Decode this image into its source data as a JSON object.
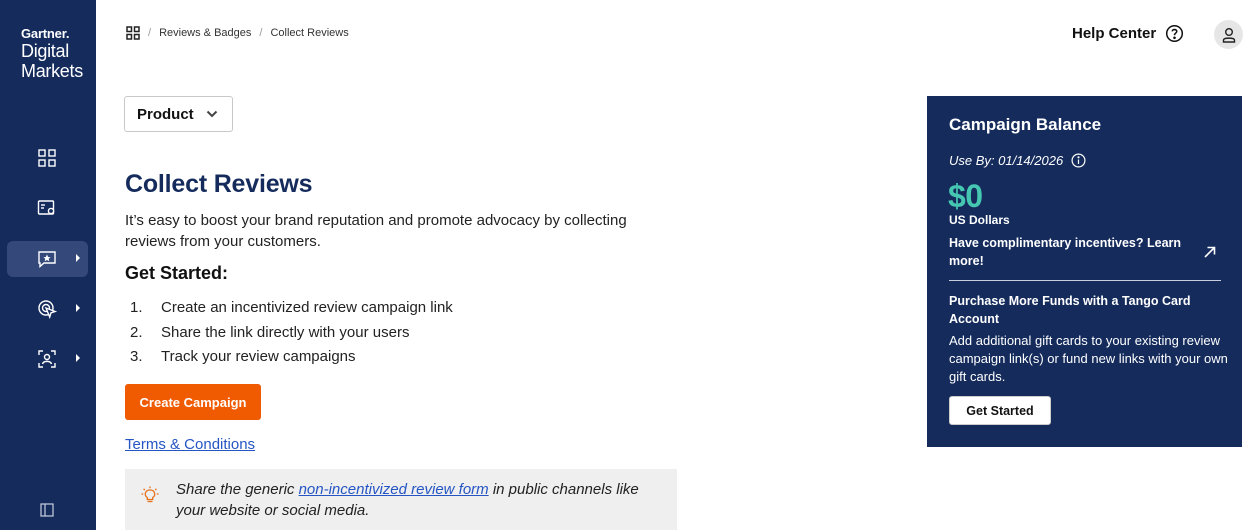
{
  "sidebar": {
    "logo": {
      "line1": "Gartner.",
      "line2": "Digital",
      "line3": "Markets"
    },
    "items": [
      {
        "icon": "dashboard-grid-icon",
        "has_arrow": false,
        "active": false
      },
      {
        "icon": "settings-card-icon",
        "has_arrow": false,
        "active": false
      },
      {
        "icon": "star-message-icon",
        "has_arrow": true,
        "active": true
      },
      {
        "icon": "cursor-click-icon",
        "has_arrow": true,
        "active": false
      },
      {
        "icon": "user-scan-icon",
        "has_arrow": true,
        "active": false
      }
    ],
    "collapse_icon": "sidebar-collapse-icon"
  },
  "header": {
    "breadcrumb": [
      "Reviews & Badges",
      "Collect Reviews"
    ],
    "help_label": "Help Center"
  },
  "main": {
    "product_dropdown": "Product",
    "title": "Collect Reviews",
    "intro": "It’s easy to boost your brand reputation and promote advocacy by collecting reviews from your customers.",
    "get_started_heading": "Get Started:",
    "steps": [
      {
        "num": "1.",
        "text": "Create an incentivized review campaign link"
      },
      {
        "num": "2.",
        "text": "Share the link directly with your users"
      },
      {
        "num": "3.",
        "text": "Track your review campaigns"
      }
    ],
    "cta": "Create Campaign",
    "terms": "Terms & Conditions",
    "note": {
      "before": "Share the generic ",
      "link": "non-incentivized review form",
      "after": " in public channels like your website or social media."
    }
  },
  "panel": {
    "title": "Campaign Balance",
    "use_by": "Use By: 01/14/2026",
    "amount": "$0",
    "currency": "US Dollars",
    "complimentary": "Have complimentary incentives? Learn more!",
    "purchase_heading": "Purchase More Funds with a Tango Card Account",
    "description": "Add additional gift cards to your existing review campaign link(s) or fund new links with your own gift cards.",
    "button": "Get Started"
  },
  "colors": {
    "sidebar_bg": "#142b5c",
    "accent_orange": "#f05a00",
    "amount_teal": "#45c7b1",
    "link_blue": "#2555c4"
  }
}
